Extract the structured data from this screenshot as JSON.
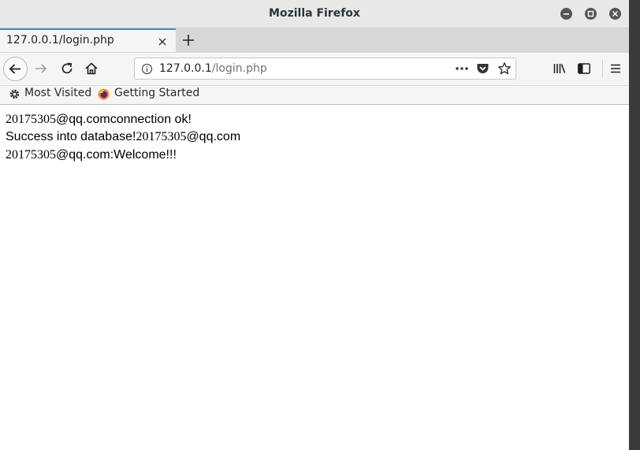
{
  "window": {
    "title": "Mozilla Firefox"
  },
  "tab": {
    "title": "127.0.0.1/login.php"
  },
  "urlbar": {
    "host": "127.0.0.1",
    "path": "/login.php"
  },
  "bookmarks": [
    {
      "label": "Most Visited"
    },
    {
      "label": "Getting Started"
    }
  ],
  "page": {
    "lines": [
      {
        "num": "20175305",
        "rest": "@qq.comconnection ok!"
      },
      {
        "pre": "Success into database!",
        "num": "20175305",
        "rest": "@qq.com"
      },
      {
        "num": "20175305",
        "rest": "@qq.com:Welcome!!!"
      }
    ]
  },
  "colors": {
    "tab_accent": "#3b8ee0",
    "chrome_bg": "#f5f5f5",
    "titlebar_bg": "#e8e8e7"
  },
  "icons": [
    "minimize-icon",
    "maximize-icon",
    "close-icon",
    "tab-close-icon",
    "new-tab-icon",
    "back-icon",
    "forward-icon",
    "reload-icon",
    "home-icon",
    "info-icon",
    "page-actions-icon",
    "pocket-icon",
    "bookmark-star-icon",
    "library-icon",
    "sidebar-icon",
    "menu-icon",
    "gear-icon",
    "firefox-icon"
  ]
}
